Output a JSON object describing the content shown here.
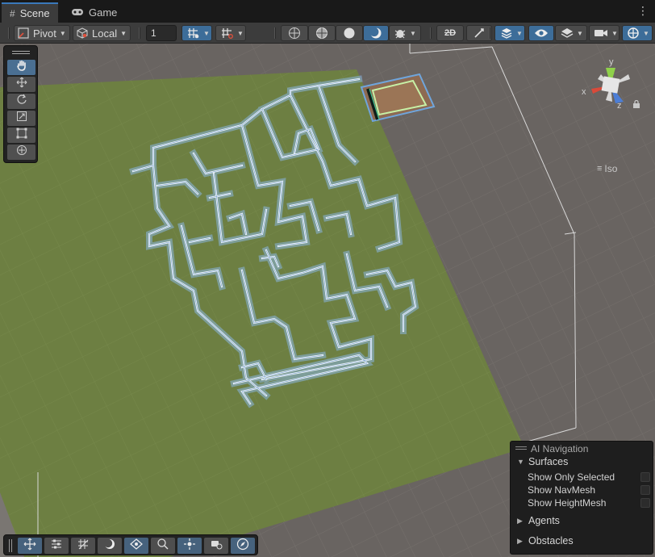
{
  "tabs": [
    {
      "label": "Scene",
      "icon": "grid-icon",
      "active": true
    },
    {
      "label": "Game",
      "icon": "gamepad-icon",
      "active": false
    }
  ],
  "toolbar": {
    "pivot_label": "Pivot",
    "space_label": "Local",
    "grid_size_value": "1",
    "render_mode_label": "Iso"
  },
  "tools": [
    {
      "name": "hand-tool",
      "icon": "hand-icon",
      "active": true
    },
    {
      "name": "move-tool",
      "icon": "move-icon"
    },
    {
      "name": "rotate-tool",
      "icon": "rotate-icon"
    },
    {
      "name": "scale-tool",
      "icon": "scale-icon"
    },
    {
      "name": "rect-tool",
      "icon": "rect-icon"
    },
    {
      "name": "transform-tool",
      "icon": "transform-icon"
    }
  ],
  "gizmo": {
    "y": "y",
    "x": "x",
    "z": "z",
    "view_label": "Iso"
  },
  "ai_navigation": {
    "title": "AI Navigation",
    "surfaces_label": "Surfaces",
    "options": [
      {
        "label": "Show Only Selected",
        "checked": false
      },
      {
        "label": "Show NavMesh",
        "checked": false
      },
      {
        "label": "Show HeightMesh",
        "checked": false
      }
    ],
    "agents_label": "Agents",
    "obstacles_label": "Obstacles"
  },
  "colors": {
    "ground": "#6d7f42",
    "background": "#696461",
    "navmesh_outline": "#6fa5dc",
    "accent": "#3d6d99"
  }
}
